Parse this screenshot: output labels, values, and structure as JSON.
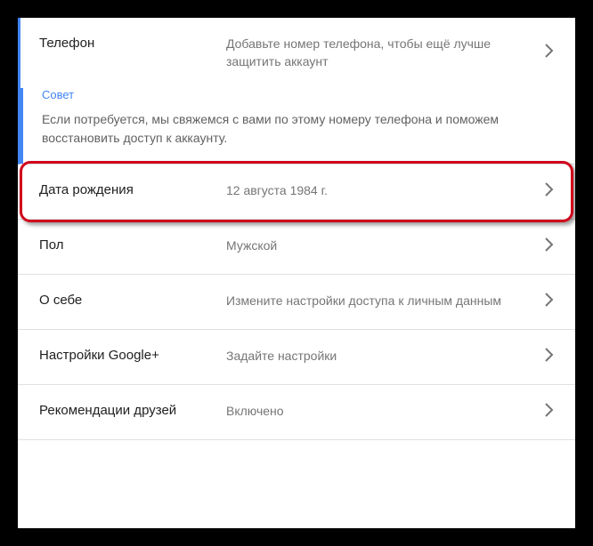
{
  "phone": {
    "label": "Телефон",
    "value": "Добавьте номер телефона, чтобы ещё лучше защитить аккаунт"
  },
  "tip": {
    "label": "Совет",
    "text": "Если потребуется, мы свяжемся с вами по этому номеру телефона и поможем восстановить доступ к аккаунту."
  },
  "birthdate": {
    "label": "Дата рождения",
    "value": "12 августа 1984 г."
  },
  "gender": {
    "label": "Пол",
    "value": "Мужской"
  },
  "about": {
    "label": "О себе",
    "value": "Измените настройки доступа к личным данным"
  },
  "googleplus": {
    "label": "Настройки Google+",
    "value": "Задайте настройки"
  },
  "recommendations": {
    "label": "Рекомендации друзей",
    "value": "Включено"
  }
}
